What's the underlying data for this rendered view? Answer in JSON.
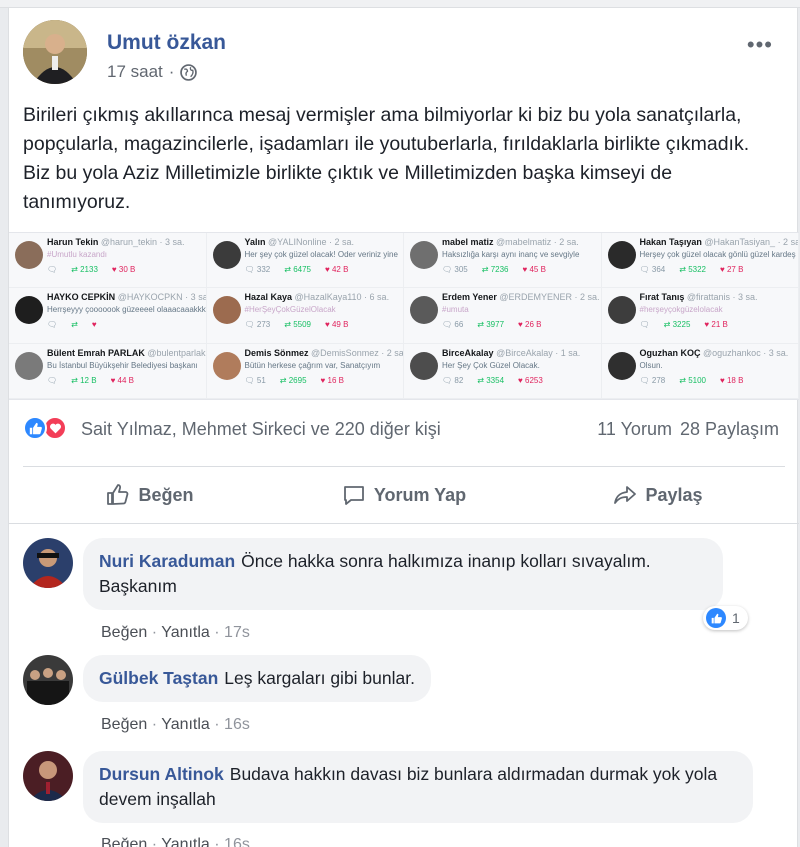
{
  "post": {
    "author": "Umut özkan",
    "timestamp": "17 saat",
    "privacy_icon": "globe-icon",
    "text": "Birileri çıkmış akıllarınca mesaj vermişler ama bilmiyorlar ki biz bu yola sanatçılarla, popçularla, magazincilerle, işadamları ile youtuberlarla, fırıldaklarla birlikte çıkmadık. Biz bu yola Aziz Milletimizle birlikte çıktık ve Milletimizden başka kimseyi de tanımıyoruz."
  },
  "tweets": [
    {
      "name": "Harun Tekin",
      "handle": "@harun_tekin · 3 sa.",
      "text": "#Umutlu kazandı",
      "reply": "",
      "rt": "2133",
      "like": "30 B",
      "color": "#8a6d5a"
    },
    {
      "name": "Yalın",
      "handle": "@YALINonline · 2 sa.",
      "text": "Her şey çok güzel olacak! Oder veriniz yine",
      "reply": "332",
      "rt": "6475",
      "like": "42 B",
      "color": "#3b3b3b"
    },
    {
      "name": "mabel matiz",
      "handle": "@mabelmatiz · 2 sa.",
      "text": "Haksızlığa karşı aynı inanç ve sevgiyle",
      "reply": "305",
      "rt": "7236",
      "like": "45 B",
      "color": "#6f6f6f"
    },
    {
      "name": "Hakan Taşıyan",
      "handle": "@HakanTasiyan_ · 2 sa.",
      "text": "Herşey çok güzel olacak gönlü güzel kardeş",
      "reply": "364",
      "rt": "5322",
      "like": "27 B",
      "color": "#2a2a2a"
    },
    {
      "name": "HAYKO CEPKİN",
      "handle": "@HAYKOCPKN · 3 sa.",
      "text": "Herrşeyyy çooooook güzeeeel olaaacaaakkk",
      "reply": "",
      "rt": "",
      "like": "",
      "color": "#1e1e1e"
    },
    {
      "name": "Hazal Kaya",
      "handle": "@HazalKaya110 · 6 sa.",
      "text": "#HerŞeyÇokGüzelOlacak",
      "reply": "273",
      "rt": "5509",
      "like": "49 B",
      "color": "#9c6b4f"
    },
    {
      "name": "Erdem Yener",
      "handle": "@ERDEMYENER · 2 sa.",
      "text": "#umuta",
      "reply": "66",
      "rt": "3977",
      "like": "26 B",
      "color": "#5a5a5a"
    },
    {
      "name": "Fırat Tanış",
      "handle": "@firattanis · 3 sa.",
      "text": "#herşeyçokgüzelolacak",
      "reply": "",
      "rt": "3225",
      "like": "21 B",
      "color": "#3d3d3d"
    },
    {
      "name": "Bülent Emrah PARLAK",
      "handle": "@bulentparlak · 3 sa.",
      "text": "Bu İstanbul Büyükşehir Belediyesi başkanı",
      "reply": "",
      "rt": "12 B",
      "like": "44 B",
      "color": "#7a7a7a"
    },
    {
      "name": "Demis Sönmez",
      "handle": "@DemisSonmez · 2 sa.",
      "text": "Bütün herkese çağrım var, Sanatçıyım",
      "reply": "51",
      "rt": "2695",
      "like": "16 B",
      "color": "#b07c5c"
    },
    {
      "name": "BirceAkalay",
      "handle": "@BirceAkalay · 1 sa.",
      "text": "Her Şey Çok Güzel Olacak.",
      "reply": "82",
      "rt": "3354",
      "like": "6253",
      "color": "#4d4d4d"
    },
    {
      "name": "Oguzhan KOÇ",
      "handle": "@oguzhankoc · 3 sa.",
      "text": "Olsun.",
      "reply": "278",
      "rt": "5100",
      "like": "18 B",
      "color": "#2f2f2f"
    }
  ],
  "stats": {
    "reactors": "Sait Yılmaz, Mehmet Sirkeci ve 220 diğer kişi",
    "comments": "11 Yorum",
    "shares": "28 Paylaşım"
  },
  "actions": {
    "like": "Beğen",
    "comment": "Yorum Yap",
    "share": "Paylaş"
  },
  "comments": [
    {
      "name": "Nuri Karaduman",
      "text": "Önce hakka sonra halkımıza inanıp kolları sıvayalım. Başkanım",
      "like_label": "Beğen",
      "reply_label": "Yanıtla",
      "time": "17s",
      "reaction_count": "1"
    },
    {
      "name": "Gülbek Taştan",
      "text": "Leş kargaları gibi bunlar.",
      "like_label": "Beğen",
      "reply_label": "Yanıtla",
      "time": "16s"
    },
    {
      "name": "Dursun Altinok",
      "text": "Budava hakkın davası biz bunlara aldırmadan durmak yok yola devem inşallah",
      "like_label": "Beğen",
      "reply_label": "Yanıtla",
      "time": "16s"
    }
  ],
  "colors": {
    "link": "#385898",
    "like_blue": "#2d88ff",
    "love_red": "#f33e58",
    "muted": "#606770"
  }
}
